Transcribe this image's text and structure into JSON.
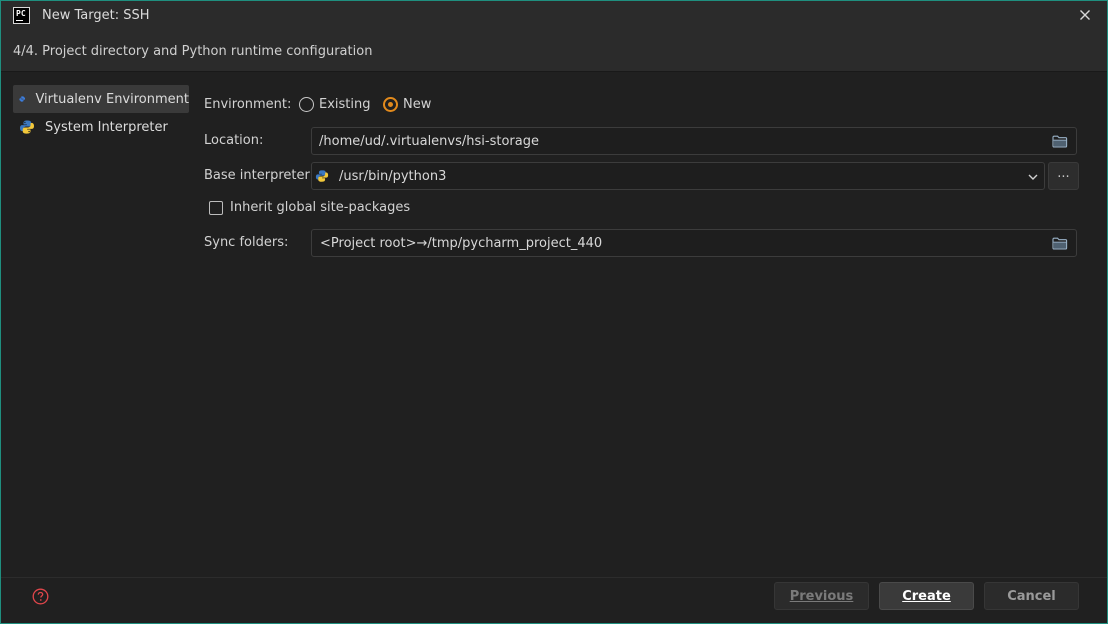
{
  "window": {
    "title": "New Target: SSH",
    "logo_text": "PC",
    "close_icon": "close-icon"
  },
  "step": {
    "text": "4/4. Project directory and Python runtime configuration"
  },
  "sidebar": {
    "items": [
      {
        "label": "Virtualenv Environment",
        "icon": "virtualenv-icon",
        "selected": true
      },
      {
        "label": "System Interpreter",
        "icon": "python-icon",
        "selected": false
      }
    ]
  },
  "form": {
    "environment_label": "Environment:",
    "environment_options": [
      {
        "label": "Existing",
        "checked": false
      },
      {
        "label": "New",
        "checked": true
      }
    ],
    "location_label": "Location:",
    "location_value": "/home/ud/.virtualenvs/hsi-storage",
    "base_interpreter_label": "Base interpreter:",
    "base_interpreter_value": "/usr/bin/python3",
    "browse_label": "...",
    "inherit_label": "Inherit global site-packages",
    "inherit_checked": false,
    "sync_label": "Sync folders:",
    "sync_value": "<Project root>→/tmp/pycharm_project_440"
  },
  "footer": {
    "previous_label": "Previous",
    "create_label": "Create",
    "cancel_label": "Cancel"
  },
  "colors": {
    "accent_radio": "#e28a1c",
    "window_border": "#1f8f7f",
    "help_icon": "#e0464b"
  }
}
